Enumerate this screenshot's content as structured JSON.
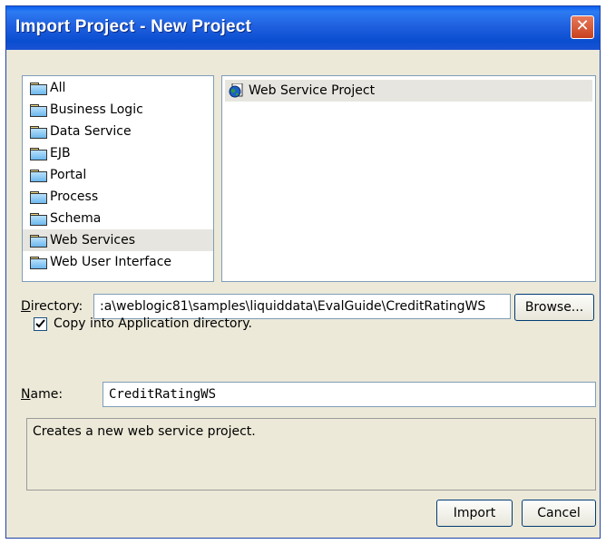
{
  "window": {
    "title": "Import Project - New Project",
    "close_symbol": "✕"
  },
  "categories": [
    {
      "label": "All",
      "icon": "folder-icon"
    },
    {
      "label": "Business Logic",
      "icon": "folder-icon"
    },
    {
      "label": "Data Service",
      "icon": "folder-icon"
    },
    {
      "label": "EJB",
      "icon": "folder-icon"
    },
    {
      "label": "Portal",
      "icon": "folder-icon"
    },
    {
      "label": "Process",
      "icon": "folder-icon"
    },
    {
      "label": "Schema",
      "icon": "folder-icon"
    },
    {
      "label": "Web Services",
      "icon": "folder-icon",
      "selected": true
    },
    {
      "label": "Web User Interface",
      "icon": "folder-icon"
    }
  ],
  "project_types": [
    {
      "label": "Web Service Project",
      "icon": "globe-icon",
      "selected": true
    }
  ],
  "directory": {
    "label_first": "D",
    "label_rest": "irectory:",
    "value": ":a\\weblogic81\\samples\\liquiddata\\EvalGuide\\CreditRatingWS",
    "browse_label": "Browse..."
  },
  "copy_option": {
    "label": "Copy into Application directory.",
    "checked": true
  },
  "name_field": {
    "label_first": "N",
    "label_rest": "ame:",
    "value": "CreditRatingWS"
  },
  "description": "Creates a new web service project.",
  "buttons": {
    "import": "Import",
    "cancel": "Cancel"
  },
  "colors": {
    "title_bar": "#2060e0",
    "dialog_bg": "#ece9d8",
    "selection": "#e6e5df"
  }
}
